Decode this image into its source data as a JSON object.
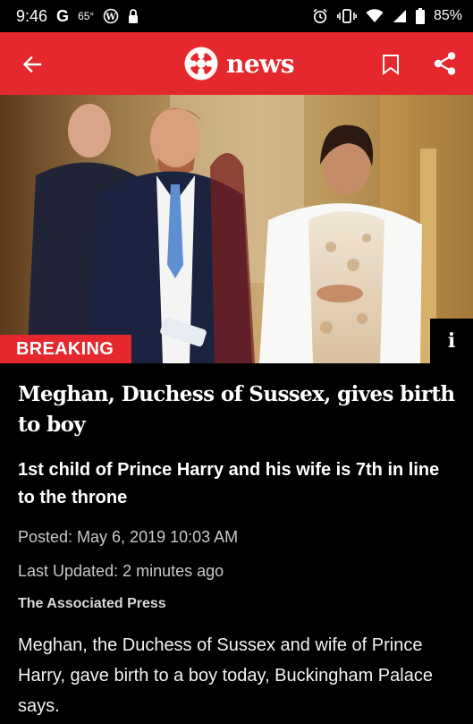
{
  "status_bar": {
    "time": "9:46",
    "google_glyph": "G",
    "temperature": "65°",
    "battery_percent": "85%",
    "icons": [
      "google-icon",
      "wordpress-icon",
      "lock-icon",
      "alarm-icon",
      "vibrate-icon",
      "wifi-icon",
      "signal-icon",
      "battery-icon"
    ]
  },
  "app_bar": {
    "brand_text": "news",
    "icons": [
      "back-arrow-icon",
      "cbc-gem-logo",
      "bookmark-icon",
      "share-icon"
    ],
    "background": "#e4282d"
  },
  "hero": {
    "badge": "BREAKING",
    "info_label": "i",
    "badge_color": "#e4282d"
  },
  "article": {
    "headline": "Meghan, Duchess of Sussex, gives birth to boy",
    "subhead": "1st child of Prince Harry and his wife is 7th in line to the throne",
    "posted": "Posted: May 6, 2019 10:03 AM",
    "last_updated": "Last Updated: 2 minutes ago",
    "source": "The Associated Press",
    "body": "Meghan, the Duchess of Sussex and wife of Prince Harry, gave birth to a boy today, Buckingham Palace says."
  }
}
